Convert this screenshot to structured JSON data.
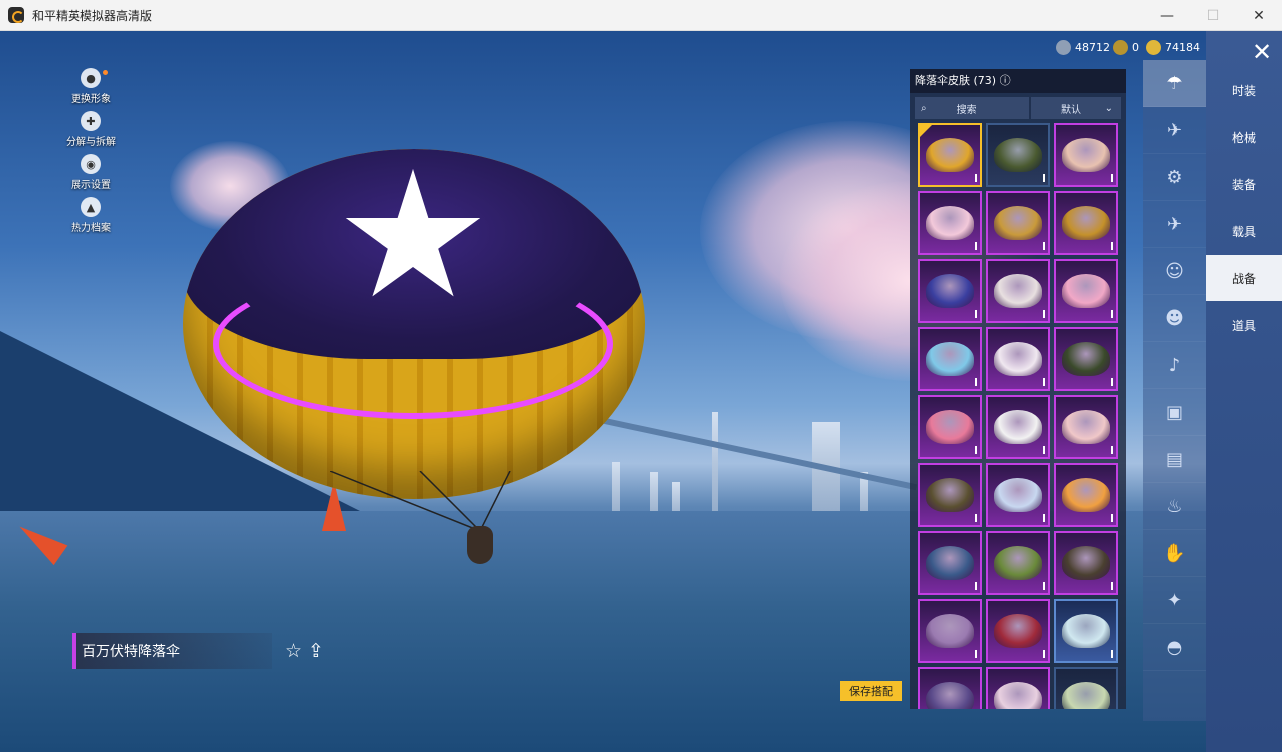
{
  "window": {
    "title": "和平精英模拟器高清版",
    "minimize": "—",
    "maximize": "☐",
    "close": "✕"
  },
  "left_menu": [
    {
      "label": "更换形象",
      "icon": "avatar-icon"
    },
    {
      "label": "分解与拆解",
      "icon": "puzzle-icon"
    },
    {
      "label": "展示设置",
      "icon": "eye-icon"
    },
    {
      "label": "热力档案",
      "icon": "flame-icon"
    }
  ],
  "currency": [
    {
      "value": "48712",
      "icon": "silver-coin-icon",
      "color": "#8f9fb5"
    },
    {
      "value": "0",
      "icon": "gold-badge-icon",
      "color": "#b89430"
    },
    {
      "value": "74184",
      "icon": "gold-coin-icon",
      "color": "#e0b73a"
    }
  ],
  "item": {
    "name": "百万伏特降落伞"
  },
  "panel": {
    "title": "降落伞皮肤 (73) ⓘ",
    "search_label": "搜索",
    "sort_label": "默认",
    "items": [
      {
        "style": "selected",
        "color": "#e0a62b"
      },
      {
        "style": "green",
        "color": "#4a5a30"
      },
      {
        "style": "purple",
        "color": "#e8c2b0"
      },
      {
        "style": "purple",
        "color": "#f3c9da"
      },
      {
        "style": "purple",
        "color": "#c99a3a"
      },
      {
        "style": "purple",
        "color": "#c4912a"
      },
      {
        "style": "purple",
        "color": "#3a3fa0"
      },
      {
        "style": "purple",
        "color": "#e8e0e0"
      },
      {
        "style": "purple",
        "color": "#f1a8c6"
      },
      {
        "style": "purple",
        "color": "#7fc9e8"
      },
      {
        "style": "purple",
        "color": "#f0e8f0"
      },
      {
        "style": "purple",
        "color": "#3a4a2a"
      },
      {
        "style": "purple",
        "color": "#e87a9a"
      },
      {
        "style": "purple",
        "color": "#f2f2f2"
      },
      {
        "style": "purple",
        "color": "#f0c8c8"
      },
      {
        "style": "purple",
        "color": "#5a5030"
      },
      {
        "style": "purple",
        "color": "#c8d8f0"
      },
      {
        "style": "purple",
        "color": "#f0a040"
      },
      {
        "style": "purple",
        "color": "#3a5a8a"
      },
      {
        "style": "purple",
        "color": "#6a8a3a"
      },
      {
        "style": "purple",
        "color": "#4a4030"
      },
      {
        "style": "purple",
        "color": "#9a7ab0"
      },
      {
        "style": "purple",
        "color": "#a02a3a"
      },
      {
        "style": "blue",
        "color": "#d0e8f0"
      },
      {
        "style": "purple",
        "color": "#5a4a8a"
      },
      {
        "style": "purple",
        "color": "#e8d0e0"
      },
      {
        "style": "green",
        "color": "#c8d8b0"
      }
    ]
  },
  "save_button": "保存搭配",
  "category_icons": [
    "parachute-icon",
    "glider-icon",
    "drone-icon",
    "plane-icon",
    "emote-icon",
    "robot-icon",
    "speaker-icon",
    "card-icon",
    "photo-icon",
    "extinguisher-icon",
    "hand-icon",
    "sparkle-icon",
    "helmet-icon"
  ],
  "tabs": [
    {
      "label": "时装",
      "active": false
    },
    {
      "label": "枪械",
      "active": false
    },
    {
      "label": "装备",
      "active": false
    },
    {
      "label": "载具",
      "active": false
    },
    {
      "label": "战备",
      "active": true
    },
    {
      "label": "道具",
      "active": false
    }
  ]
}
